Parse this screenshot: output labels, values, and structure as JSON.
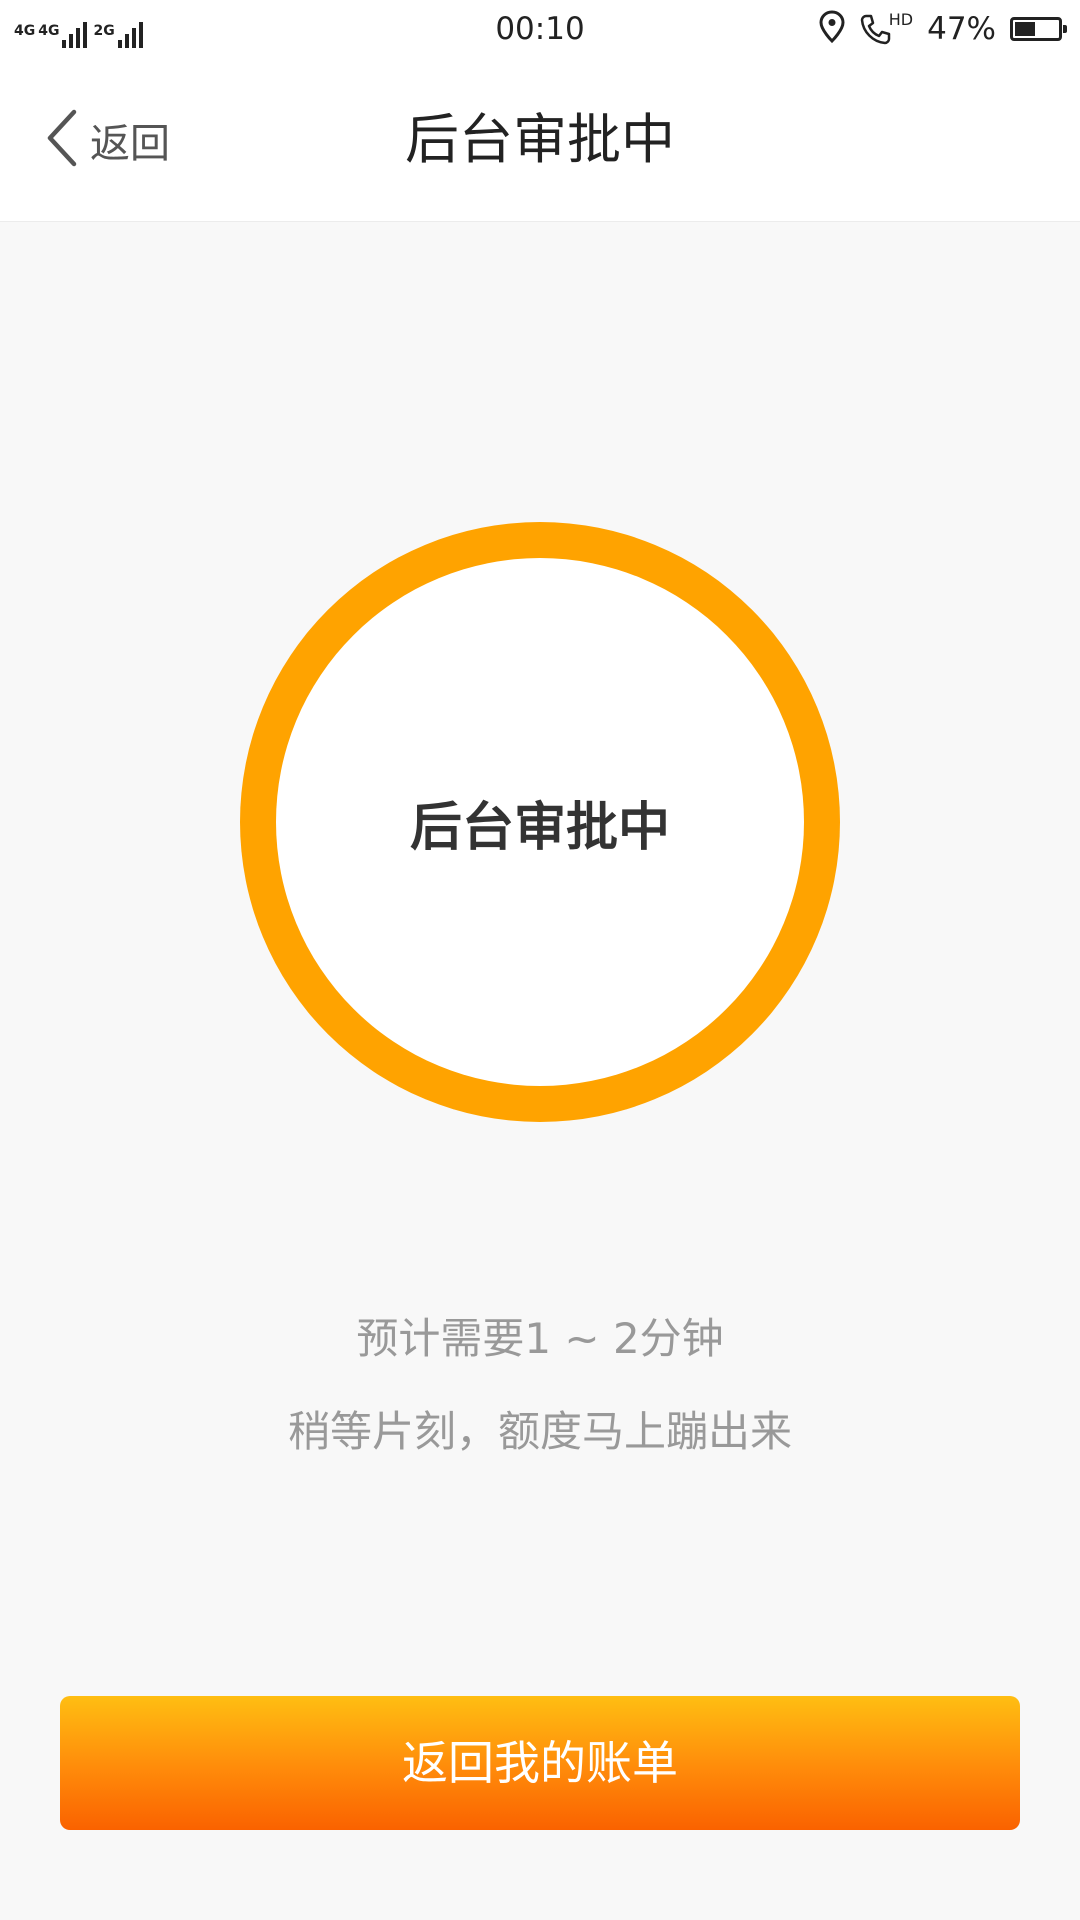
{
  "status_bar": {
    "network_1": "4G",
    "network_2": "4G",
    "network_3": "2G",
    "time": "00:10",
    "call_badge": "HD",
    "battery_percent_label": "47%",
    "battery_level": 0.47
  },
  "nav": {
    "back_label": "返回",
    "title": "后台审批中"
  },
  "status_ring": {
    "label": "后台审批中",
    "accent_color": "#ffa300"
  },
  "messages": {
    "line1": "预计需要1 ~ 2分钟",
    "line2": "稍等片刻，额度马上蹦出来"
  },
  "actions": {
    "primary_label": "返回我的账单"
  },
  "icons": {
    "back": "chevron-left-icon",
    "location": "location-pin-icon",
    "call": "hd-call-icon",
    "battery": "battery-icon",
    "signal": "signal-bars-icon"
  }
}
